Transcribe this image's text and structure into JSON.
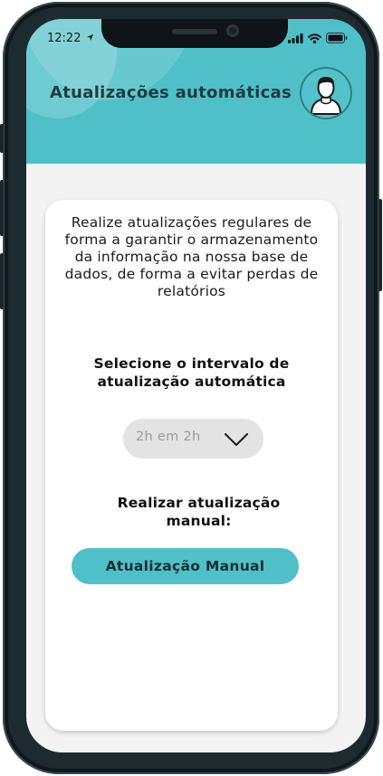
{
  "status_bar": {
    "time": "12:22",
    "icons": [
      "location-arrow-icon",
      "signal-icon",
      "wifi-icon",
      "battery-icon"
    ]
  },
  "header": {
    "title": "Atualizações automáticas",
    "avatar_icon": "user-icon",
    "accent_color": "#4fc0c8"
  },
  "card": {
    "description": "Realize atualizações regulares de forma a garantir o armazenamento da informação na nossa base de dados, de forma a evitar perdas de relatórios",
    "interval_label": "Selecione o intervalo de atualização automática",
    "interval_selected": "2h em 2h",
    "dropdown_icon": "chevron-down-icon",
    "manual_label": "Realizar atualização manual:",
    "manual_button": "Atualização Manual"
  }
}
